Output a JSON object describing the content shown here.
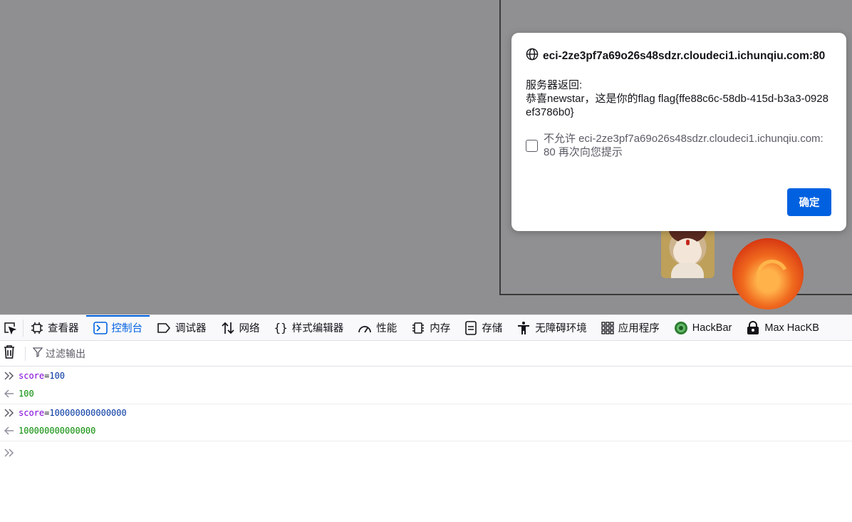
{
  "dialog": {
    "origin": "eci-2ze3pf7a69o26s48sdzr.cloudeci1.ichunqiu.com:80",
    "message_line1": "服务器返回:",
    "message_line2": "恭喜newstar，这是你的flag flag{ffe88c6c-58db-415d-b3a3-0928ef3786b0}",
    "checkbox_label": "不允许 eci-2ze3pf7a69o26s48sdzr.cloudeci1.ichunqiu.com:80 再次向您提示",
    "checkbox_checked": false,
    "ok_label": "确定"
  },
  "devtools": {
    "tabs": [
      {
        "label": "查看器",
        "icon": "inspector-icon"
      },
      {
        "label": "控制台",
        "icon": "console-icon",
        "selected": true
      },
      {
        "label": "调试器",
        "icon": "debugger-icon"
      },
      {
        "label": "网络",
        "icon": "network-icon"
      },
      {
        "label": "样式编辑器",
        "icon": "style-editor-icon"
      },
      {
        "label": "性能",
        "icon": "performance-icon"
      },
      {
        "label": "内存",
        "icon": "memory-icon"
      },
      {
        "label": "存储",
        "icon": "storage-icon"
      },
      {
        "label": "无障碍环境",
        "icon": "accessibility-icon"
      },
      {
        "label": "应用程序",
        "icon": "application-icon"
      },
      {
        "label": "HackBar",
        "icon": "hackbar-icon"
      },
      {
        "label": "Max HacKB",
        "icon": "max-hackbar-icon"
      }
    ],
    "filter_placeholder": "过滤输出",
    "accent_color": "#0061e0"
  },
  "console": {
    "entries": [
      {
        "input_var": "score",
        "input_op": "=",
        "input_value": "100",
        "output": "100"
      },
      {
        "input_var": "score",
        "input_op": "=",
        "input_value": "100000000000000",
        "output": "100000000000000"
      }
    ]
  }
}
